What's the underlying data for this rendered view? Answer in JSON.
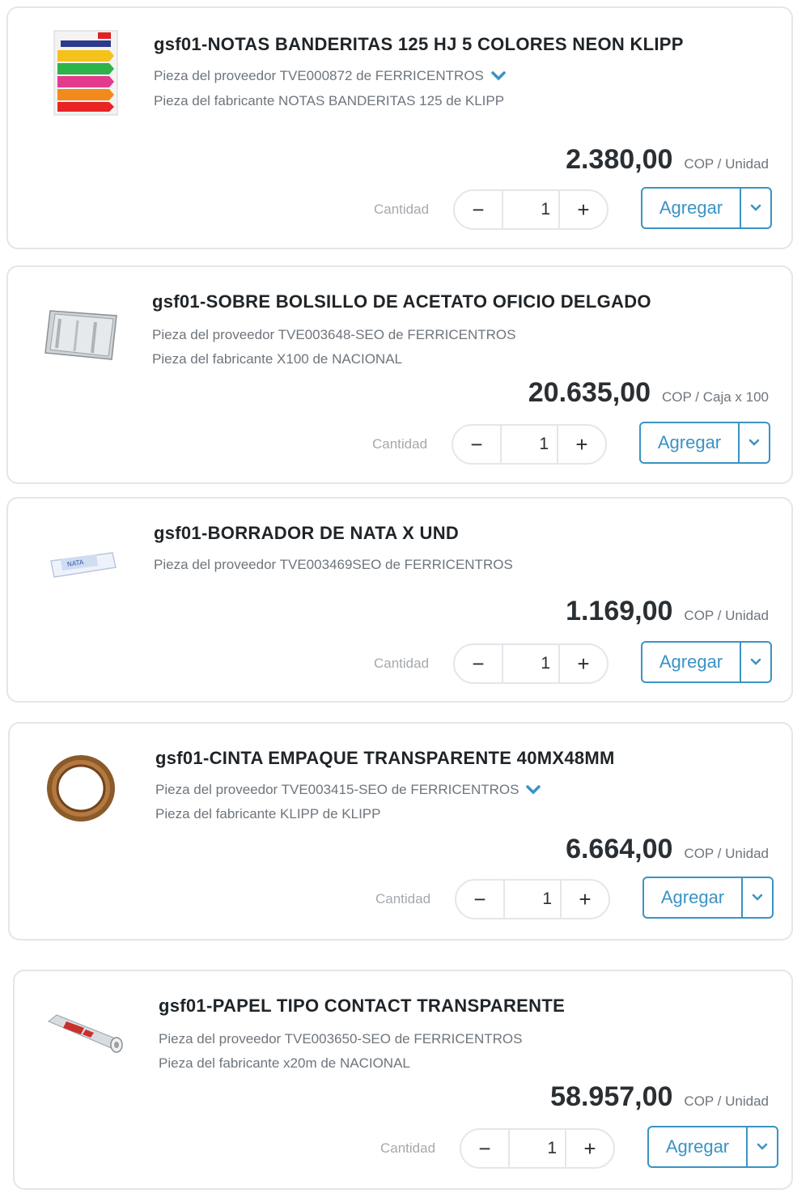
{
  "qty_label": "Cantidad",
  "add_label": "Agregar",
  "accent_color": "#3a93c4",
  "products": [
    {
      "title": "gsf01-NOTAS BANDERITAS 125 HJ 5 COLORES NEON KLIPP",
      "supplier": "Pieza del proveedor TVE000872 de FERRICENTROS",
      "supplier_has_toggle": true,
      "manufacturer": "Pieza del fabricante NOTAS BANDERITAS 125 de KLIPP",
      "price": "2.380,00",
      "unit": "COP / Unidad",
      "quantity": "1",
      "image": "sticky-flags-icon"
    },
    {
      "title": "gsf01-SOBRE BOLSILLO DE ACETATO OFICIO DELGADO",
      "supplier": "Pieza del proveedor TVE003648-SEO de FERRICENTROS",
      "supplier_has_toggle": false,
      "manufacturer": "Pieza del fabricante X100 de NACIONAL",
      "price": "20.635,00",
      "unit": "COP / Caja x 100",
      "quantity": "1",
      "image": "acetate-sleeve-icon"
    },
    {
      "title": "gsf01-BORRADOR DE NATA X UND",
      "supplier": "Pieza del proveedor TVE003469SEO de FERRICENTROS",
      "supplier_has_toggle": false,
      "manufacturer": "",
      "price": "1.169,00",
      "unit": "COP / Unidad",
      "quantity": "1",
      "image": "eraser-icon"
    },
    {
      "title": "gsf01-CINTA EMPAQUE  TRANSPARENTE  40MX48MM",
      "supplier": "Pieza del proveedor TVE003415-SEO de FERRICENTROS",
      "supplier_has_toggle": true,
      "manufacturer": "Pieza del fabricante KLIPP de KLIPP",
      "price": "6.664,00",
      "unit": "COP / Unidad",
      "quantity": "1",
      "image": "tape-roll-icon"
    },
    {
      "title": "gsf01-PAPEL TIPO CONTACT TRANSPARENTE",
      "supplier": "Pieza del proveedor TVE003650-SEO de FERRICENTROS",
      "supplier_has_toggle": false,
      "manufacturer": "Pieza del fabricante x20m de NACIONAL",
      "price": "58.957,00",
      "unit": "COP / Unidad",
      "quantity": "1",
      "image": "contact-paper-roll-icon"
    }
  ]
}
